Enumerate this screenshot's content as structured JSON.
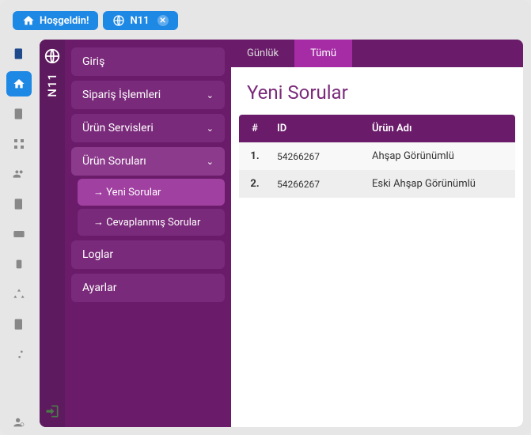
{
  "topTabs": {
    "welcome": "Hoşgeldin!",
    "n11": "N11"
  },
  "brand": {
    "label": "N11"
  },
  "sidebar": {
    "items": [
      {
        "label": "Giriş"
      },
      {
        "label": "Sipariş İşlemleri"
      },
      {
        "label": "Ürün Servisleri"
      },
      {
        "label": "Ürün Soruları"
      },
      {
        "label": "Loglar"
      },
      {
        "label": "Ayarlar"
      }
    ],
    "sub": [
      {
        "label": "→ Yeni Sorular"
      },
      {
        "label": "→ Cevaplanmış Sorular"
      }
    ]
  },
  "contentTabs": {
    "daily": "Günlük",
    "all": "Tümü"
  },
  "pageTitle": "Yeni Sorular",
  "table": {
    "head": {
      "n": "#",
      "id": "ID",
      "name": "Ürün Adı"
    },
    "rows": [
      {
        "n": "1.",
        "id": "54266267",
        "name": "Ahşap Görünümlü"
      },
      {
        "n": "2.",
        "id": "54266267",
        "name": "Eski Ahşap Görünümlü"
      }
    ]
  }
}
